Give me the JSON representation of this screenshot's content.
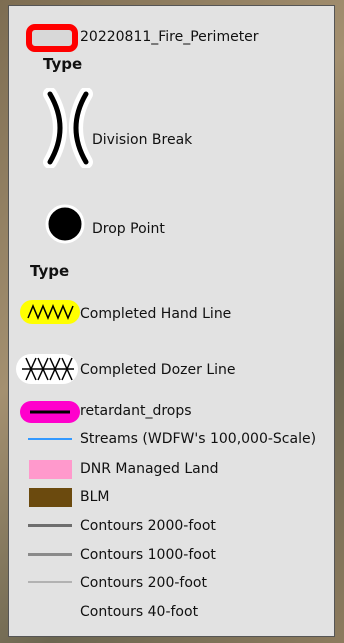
{
  "layers": {
    "fire_perimeter": {
      "label": "20220811_Fire_Perimeter",
      "outline_color": "#ff0000",
      "fill_color": "#d8d8d8"
    },
    "type_header_1": "Type",
    "division_break": {
      "label": "Division Break",
      "symbol": "division-break-icon"
    },
    "drop_point": {
      "label": "Drop Point",
      "color": "#000000"
    },
    "type_header_2": "Type",
    "hand_line": {
      "label": "Completed Hand Line",
      "color": "#ffff00"
    },
    "dozer_line": {
      "label": "Completed Dozer Line"
    },
    "retardant": {
      "label": "retardant_drops",
      "color": "#ff00cc"
    },
    "streams": {
      "label": "Streams (WDFW's 100,000-Scale)",
      "color": "#3399ff"
    },
    "dnr_land": {
      "label": "DNR Managed Land",
      "color": "#ff99cc"
    },
    "blm": {
      "label": "BLM",
      "color": "#6b4a0e"
    },
    "contours_2000": {
      "label": "Contours 2000-foot",
      "color": "#6e6e6e"
    },
    "contours_1000": {
      "label": "Contours 1000-foot",
      "color": "#8a8a8a"
    },
    "contours_200": {
      "label": "Contours 200-foot",
      "color": "#b2b2b2"
    },
    "contours_40": {
      "label": "Contours 40-foot"
    }
  }
}
